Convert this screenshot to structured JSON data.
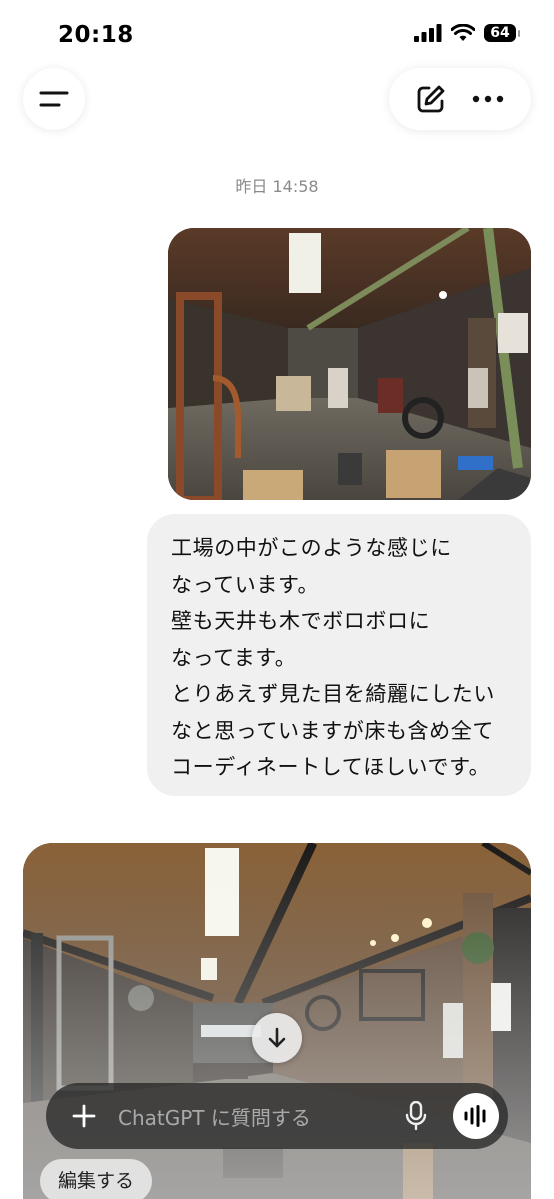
{
  "status_bar": {
    "time": "20:18",
    "battery": "64",
    "icons": [
      "signal-icon",
      "wifi-icon",
      "battery-icon"
    ]
  },
  "top_bar": {
    "icons": [
      "menu-icon",
      "new-chat-icon",
      "more-icon"
    ]
  },
  "chat": {
    "timestamp": "昨日 14:58",
    "user_message": "工場の中がこのような感じに\nなっています。\n壁も天井も木でボロボロに\nなってます。\nとりあえず見た目を綺麗にしたい\nなと思っていますが床も含め全て\nコーディネートしてほしいです。"
  },
  "composer": {
    "placeholder": "ChatGPT に質問する",
    "icons": [
      "plus-icon",
      "mic-icon",
      "voice-mode-icon"
    ]
  },
  "edit_button": "編集する",
  "colors": {
    "bubble": "#f0f0f0",
    "composer": "#2a2a2a",
    "timestamp": "#8a8a8a"
  }
}
